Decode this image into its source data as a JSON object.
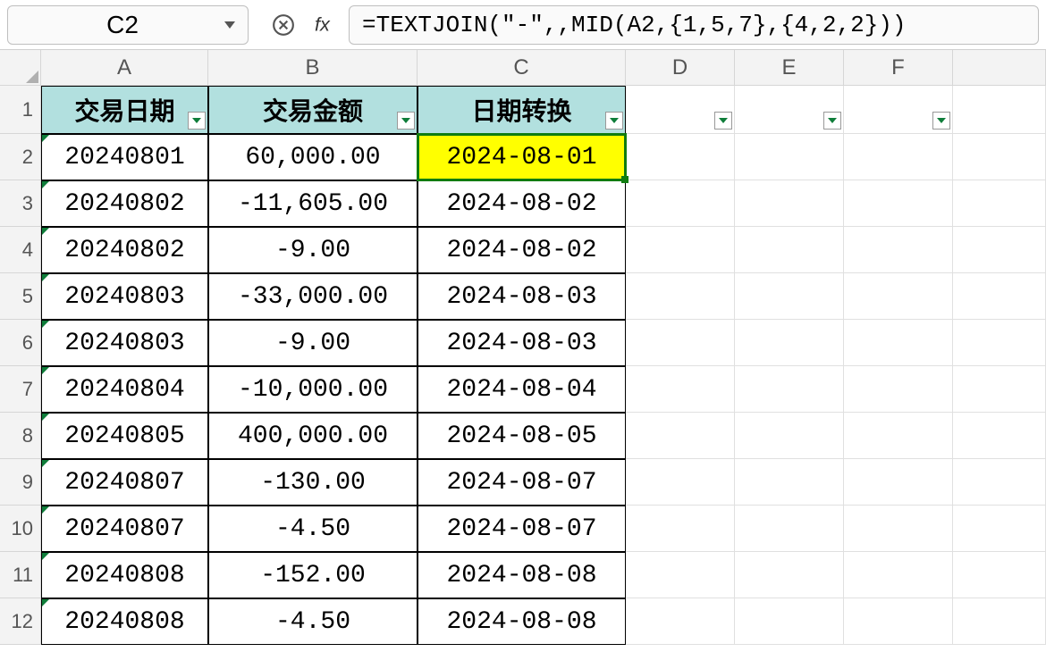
{
  "namebox": "C2",
  "formula": "=TEXTJOIN(\"-\",,MID(A2,{1,5,7},{4,2,2}))",
  "columns": [
    "A",
    "B",
    "C",
    "D",
    "E",
    "F"
  ],
  "rowcount": 12,
  "headers": {
    "A": "交易日期",
    "B": "交易金额",
    "C": "日期转换"
  },
  "rows": [
    {
      "A": "20240801",
      "B": "60,000.00",
      "C": "2024-08-01"
    },
    {
      "A": "20240802",
      "B": "-11,605.00",
      "C": "2024-08-02"
    },
    {
      "A": "20240802",
      "B": "-9.00",
      "C": "2024-08-02"
    },
    {
      "A": "20240803",
      "B": "-33,000.00",
      "C": "2024-08-03"
    },
    {
      "A": "20240803",
      "B": "-9.00",
      "C": "2024-08-03"
    },
    {
      "A": "20240804",
      "B": "-10,000.00",
      "C": "2024-08-04"
    },
    {
      "A": "20240805",
      "B": "400,000.00",
      "C": "2024-08-05"
    },
    {
      "A": "20240807",
      "B": "-130.00",
      "C": "2024-08-07"
    },
    {
      "A": "20240807",
      "B": "-4.50",
      "C": "2024-08-07"
    },
    {
      "A": "20240808",
      "B": "-152.00",
      "C": "2024-08-08"
    },
    {
      "A": "20240808",
      "B": "-4.50",
      "C": "2024-08-08"
    }
  ]
}
